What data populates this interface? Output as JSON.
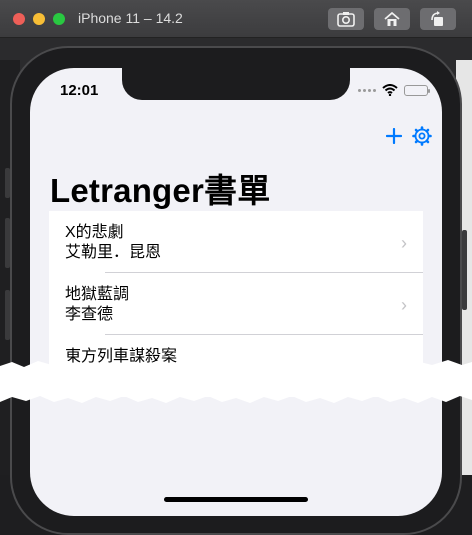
{
  "window": {
    "title": "iPhone 11 – 14.2",
    "toolbar_icons": [
      "screenshot-icon",
      "home-icon",
      "rotate-icon"
    ]
  },
  "status_bar": {
    "time": "12:01"
  },
  "nav": {
    "add_icon": "plus-icon",
    "settings_icon": "gear-icon"
  },
  "page": {
    "title": "Letranger書單"
  },
  "books": [
    {
      "title": "X的悲劇",
      "author": "艾勒里．昆恩"
    },
    {
      "title": "地獄藍調",
      "author": "李查德"
    },
    {
      "title": "東方列車謀殺案",
      "author": ""
    }
  ],
  "colors": {
    "accent": "#007aff",
    "background": "#f2f2f7"
  }
}
